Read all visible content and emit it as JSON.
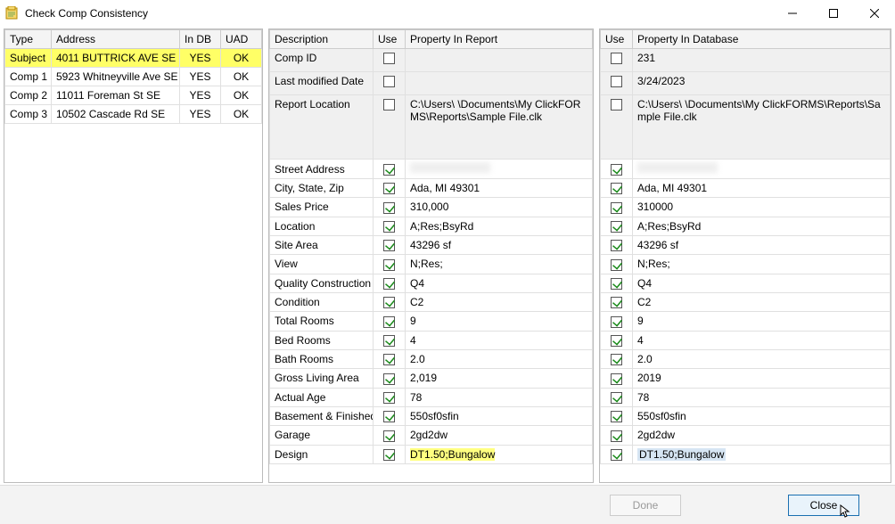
{
  "window": {
    "title": "Check Comp Consistency"
  },
  "left": {
    "headers": {
      "type": "Type",
      "address": "Address",
      "indb": "In DB",
      "uad": "UAD"
    },
    "rows": [
      {
        "type": "Subject",
        "address": "4011 BUTTRICK AVE SE",
        "indb": "YES",
        "uad": "OK",
        "hl": true
      },
      {
        "type": "Comp 1",
        "address": "5923 Whitneyville Ave SE",
        "indb": "YES",
        "uad": "OK",
        "hl": false
      },
      {
        "type": "Comp 2",
        "address": "11011 Foreman St SE",
        "indb": "YES",
        "uad": "OK",
        "hl": false
      },
      {
        "type": "Comp 3",
        "address": "10502 Cascade Rd SE",
        "indb": "YES",
        "uad": "OK",
        "hl": false
      }
    ]
  },
  "mid": {
    "headers": {
      "desc": "Description",
      "use": "Use",
      "prop": "Property In Report"
    },
    "rows": [
      {
        "desc": "Comp ID",
        "checked": false,
        "val": "",
        "tall": false,
        "blur": false
      },
      {
        "desc": "Last modified Date",
        "checked": false,
        "val": "",
        "tall": false,
        "blur": false
      },
      {
        "desc": "Report Location",
        "checked": false,
        "val": "C:\\Users\\                          \\Documents\\My ClickFORMS\\Reports\\Sample File.clk",
        "tall": true,
        "blur": false
      },
      {
        "desc": "Street Address",
        "checked": true,
        "val": "",
        "tall": false,
        "blur": true
      },
      {
        "desc": "City, State, Zip",
        "checked": true,
        "val": "Ada, MI 49301",
        "tall": false,
        "blur": false
      },
      {
        "desc": "Sales Price",
        "checked": true,
        "val": "310,000",
        "tall": false,
        "blur": false
      },
      {
        "desc": "Location",
        "checked": true,
        "val": "A;Res;BsyRd",
        "tall": false,
        "blur": false
      },
      {
        "desc": "Site Area",
        "checked": true,
        "val": "43296 sf",
        "tall": false,
        "blur": false
      },
      {
        "desc": "View",
        "checked": true,
        "val": "N;Res;",
        "tall": false,
        "blur": false
      },
      {
        "desc": "Quality Construction",
        "checked": true,
        "val": "Q4",
        "tall": false,
        "blur": false
      },
      {
        "desc": "Condition",
        "checked": true,
        "val": "C2",
        "tall": false,
        "blur": false
      },
      {
        "desc": "Total Rooms",
        "checked": true,
        "val": "9",
        "tall": false,
        "blur": false
      },
      {
        "desc": "Bed Rooms",
        "checked": true,
        "val": "4",
        "tall": false,
        "blur": false
      },
      {
        "desc": "Bath Rooms",
        "checked": true,
        "val": "2.0",
        "tall": false,
        "blur": false
      },
      {
        "desc": "Gross Living Area",
        "checked": true,
        "val": "2,019",
        "tall": false,
        "blur": false
      },
      {
        "desc": "Actual Age",
        "checked": true,
        "val": "78",
        "tall": false,
        "blur": false
      },
      {
        "desc": "Basement & Finished",
        "checked": true,
        "val": "550sf0sfin",
        "tall": false,
        "blur": false
      },
      {
        "desc": "Garage",
        "checked": true,
        "val": "2gd2dw",
        "tall": false,
        "blur": false
      },
      {
        "desc": "Design",
        "checked": true,
        "val": "DT1.50;Bungalow",
        "tall": false,
        "blur": false,
        "hl": true
      }
    ]
  },
  "right": {
    "headers": {
      "use": "Use",
      "prop": "Property In  Database"
    },
    "rows": [
      {
        "checked": false,
        "val": "231",
        "tall": false,
        "blur": false
      },
      {
        "checked": false,
        "val": "3/24/2023",
        "tall": false,
        "blur": false
      },
      {
        "checked": false,
        "val": " C:\\Users\\                         \\Documents\\My ClickFORMS\\Reports\\Sample File.clk",
        "tall": true,
        "blur": false
      },
      {
        "checked": true,
        "val": "",
        "tall": false,
        "blur": true
      },
      {
        "checked": true,
        "val": "Ada, MI 49301",
        "tall": false,
        "blur": false
      },
      {
        "checked": true,
        "val": "310000",
        "tall": false,
        "blur": false
      },
      {
        "checked": true,
        "val": "A;Res;BsyRd",
        "tall": false,
        "blur": false
      },
      {
        "checked": true,
        "val": "43296 sf",
        "tall": false,
        "blur": false
      },
      {
        "checked": true,
        "val": "N;Res;",
        "tall": false,
        "blur": false
      },
      {
        "checked": true,
        "val": "Q4",
        "tall": false,
        "blur": false
      },
      {
        "checked": true,
        "val": "C2",
        "tall": false,
        "blur": false
      },
      {
        "checked": true,
        "val": "9",
        "tall": false,
        "blur": false
      },
      {
        "checked": true,
        "val": "4",
        "tall": false,
        "blur": false
      },
      {
        "checked": true,
        "val": "2.0",
        "tall": false,
        "blur": false
      },
      {
        "checked": true,
        "val": "2019",
        "tall": false,
        "blur": false
      },
      {
        "checked": true,
        "val": "78",
        "tall": false,
        "blur": false
      },
      {
        "checked": true,
        "val": "550sf0sfin",
        "tall": false,
        "blur": false
      },
      {
        "checked": true,
        "val": "2gd2dw",
        "tall": false,
        "blur": false
      },
      {
        "checked": true,
        "val": "DT1.50;Bungalow",
        "tall": false,
        "blur": false,
        "sel": true
      }
    ]
  },
  "footer": {
    "done": "Done",
    "close": "Close"
  }
}
